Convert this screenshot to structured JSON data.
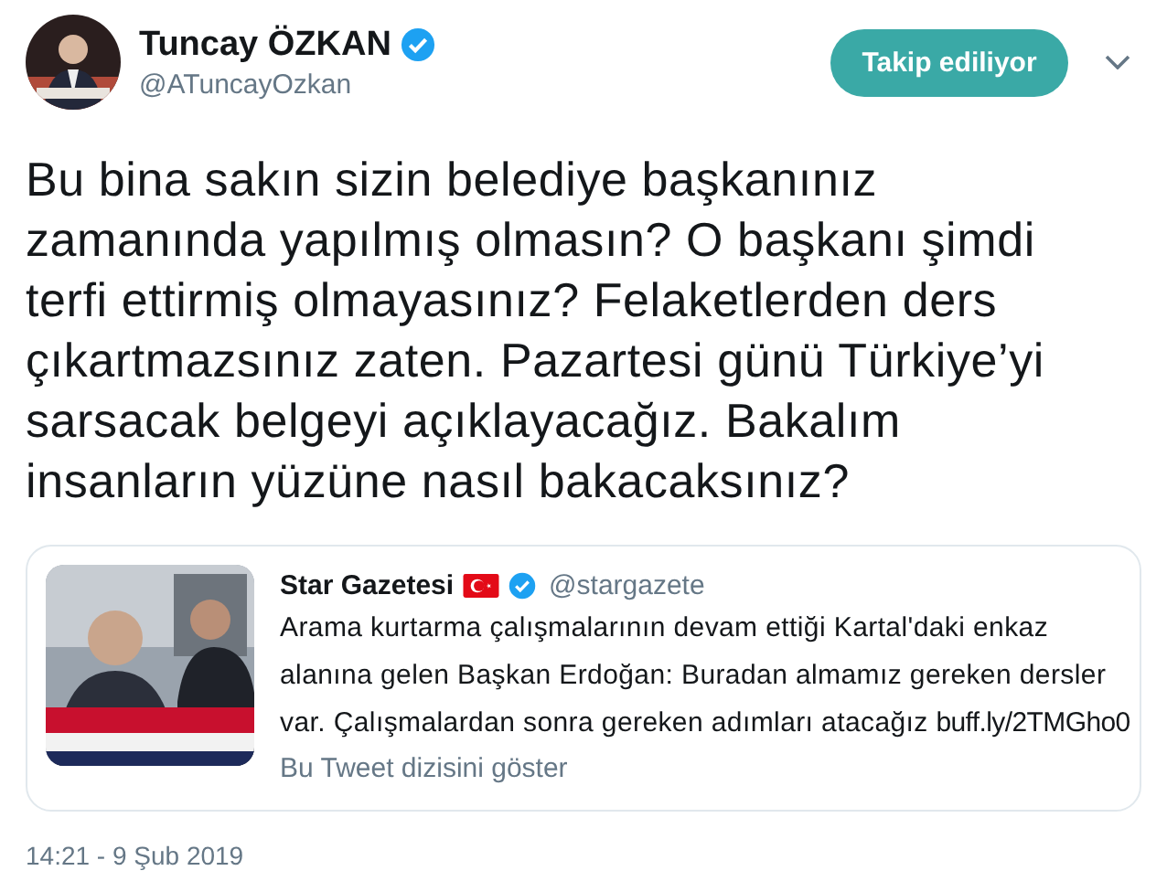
{
  "author": {
    "name": "Tuncay ÖZKAN",
    "verified": true,
    "handle": "@ATuncayOzkan"
  },
  "follow_button": {
    "label": "Takip ediliyor"
  },
  "text": "Bu bina sakın sizin belediye başkanınız zamanında yapılmış olmasın? O başkanı şimdi terfi ettirmiş olmayasınız? Felaketlerden ders çıkartmazsınız zaten. Pazartesi günü Türkiye’yi sarsacak belgeyi açıklayacağız. Bakalım insanların yüzüne nasıl bakacaksınız?",
  "quote": {
    "name": "Star Gazetesi",
    "verified": true,
    "handle": "@stargazete",
    "text": "Arama kurtarma çalışmalarının devam ettiği Kartal'daki enkaz alanına gelen Başkan Erdoğan: Buradan almamız gereken dersler var. Çalışmalardan sonra gereken adımları atacağız",
    "link": "buff.ly/2TMGho0",
    "thread_link": "Bu Tweet dizisini göster"
  },
  "timestamp": "14:21 - 9 Şub 2019"
}
